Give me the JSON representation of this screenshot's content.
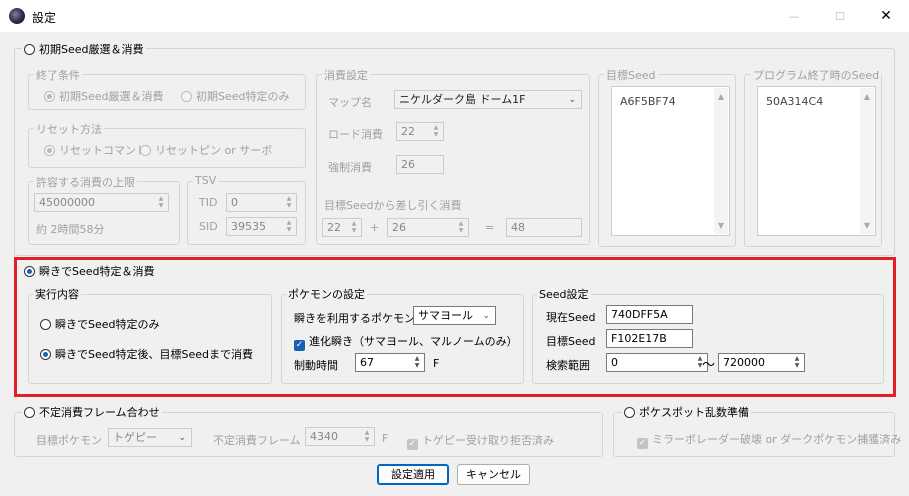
{
  "window": {
    "title": "設定",
    "min": "—",
    "max": "☐",
    "close": "✕"
  },
  "initial": {
    "title": "初期Seed厳選＆消費",
    "end": {
      "title": "終了条件",
      "opt1": "初期Seed厳選＆消費",
      "opt2": "初期Seed特定のみ"
    },
    "reset": {
      "title": "リセット方法",
      "opt1": "リセットコマンド",
      "opt2": "リセットピン or サーボ"
    },
    "limit": {
      "title": "許容する消費の上限",
      "value": "45000000",
      "approx": "約 2時間58分"
    },
    "tsv": {
      "title": "TSV",
      "tid_label": "TID",
      "tid": "0",
      "sid_label": "SID",
      "sid": "39535"
    },
    "consume": {
      "title": "消費設定",
      "map_label": "マップ名",
      "map": "ニケルダーク島 ドーム1F",
      "load_label": "ロード消費",
      "load": "22",
      "forced_label": "強制消費",
      "forced": "26",
      "sub_label": "目標Seedから差し引く消費",
      "a": "22",
      "plus": "+",
      "b": "26",
      "eq": "=",
      "c": "48"
    },
    "target": {
      "title": "目標Seed",
      "value": "A6F5BF74"
    },
    "end_seed": {
      "title": "プログラム終了時のSeed",
      "value": "50A314C4"
    }
  },
  "blink": {
    "title": "瞬きでSeed特定＆消費",
    "exec": {
      "title": "実行内容",
      "opt1": "瞬きでSeed特定のみ",
      "opt2": "瞬きでSeed特定後、目標Seedまで消費"
    },
    "poke": {
      "title": "ポケモンの設定",
      "use_label": "瞬きを利用するポケモン",
      "use": "サマヨール",
      "evo": "進化瞬き（サマヨール、マルノームのみ）",
      "time_label": "制動時間",
      "time": "67",
      "unit": "F"
    },
    "seed": {
      "title": "Seed設定",
      "cur_label": "現在Seed",
      "cur": "740DFF5A",
      "tgt_label": "目標Seed",
      "tgt": "F102E17B",
      "range_label": "検索範囲",
      "from": "0",
      "tilde": "〜",
      "to": "720000"
    }
  },
  "frame": {
    "title": "不定消費フレーム合わせ",
    "target_label": "目標ポケモン",
    "target": "トゲピー",
    "frames_label": "不定消費フレーム",
    "frames": "4340",
    "unit": "F",
    "reject": "トゲピー受け取り拒否済み"
  },
  "pokespot": {
    "title": "ポケスポット乱数準備",
    "opt": "ミラーボレーダー破壊 or ダークポケモン捕獲済み"
  },
  "buttons": {
    "apply": "設定適用",
    "cancel": "キャンセル"
  },
  "colors": {
    "accent": "#1a5fb4",
    "highlight": "#e01f26"
  }
}
